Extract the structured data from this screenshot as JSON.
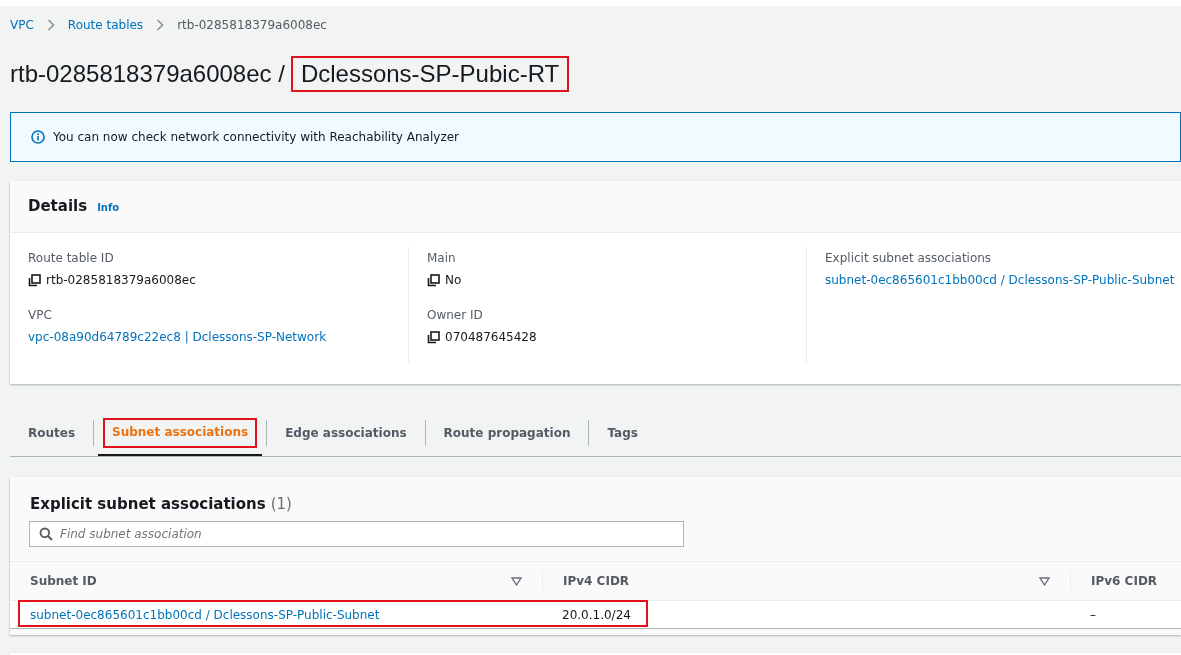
{
  "breadcrumbs": [
    {
      "label": "VPC",
      "link": true
    },
    {
      "label": "Route tables",
      "link": true
    },
    {
      "label": "rtb-0285818379a6008ec",
      "link": false
    }
  ],
  "title": {
    "id": "rtb-0285818379a6008ec /",
    "name": "Dclessons-SP-Pubic-RT",
    "highlighted": true
  },
  "info_banner": {
    "text": "You can now check network connectivity with Reachability Analyzer"
  },
  "details": {
    "heading": "Details",
    "info_link": "Info",
    "columns": [
      [
        {
          "label": "Route table ID",
          "value": "rtb-0285818379a6008ec",
          "kind": "copy"
        },
        {
          "label": "VPC",
          "value": "vpc-08a90d64789c22ec8 | Dclessons-SP-Network",
          "kind": "link"
        }
      ],
      [
        {
          "label": "Main",
          "value": "No",
          "kind": "copy"
        },
        {
          "label": "Owner ID",
          "value": "070487645428",
          "kind": "copy"
        }
      ],
      [
        {
          "label": "Explicit subnet associations",
          "value": "subnet-0ec865601c1bb00cd / Dclessons-SP-Public-Subnet",
          "kind": "link"
        }
      ]
    ]
  },
  "tabs": [
    {
      "label": "Routes",
      "selected": false,
      "highlighted": false
    },
    {
      "label": "Subnet associations",
      "selected": true,
      "highlighted": true
    },
    {
      "label": "Edge associations",
      "selected": false,
      "highlighted": false
    },
    {
      "label": "Route propagation",
      "selected": false,
      "highlighted": false
    },
    {
      "label": "Tags",
      "selected": false,
      "highlighted": false
    }
  ],
  "associations": {
    "heading": "Explicit subnet associations",
    "count": "(1)",
    "search": {
      "placeholder": "Find subnet association"
    },
    "table": {
      "columns": [
        {
          "label": "Subnet ID",
          "sortable": true
        },
        {
          "label": "IPv4 CIDR",
          "sortable": true
        },
        {
          "label": "IPv6 CIDR",
          "sortable": false
        }
      ],
      "rows": [
        {
          "subnet": "subnet-0ec865601c1bb00cd / Dclessons-SP-Public-Subnet",
          "ipv4": "20.0.1.0/24",
          "ipv6": "–",
          "highlighted": true
        }
      ]
    }
  }
}
